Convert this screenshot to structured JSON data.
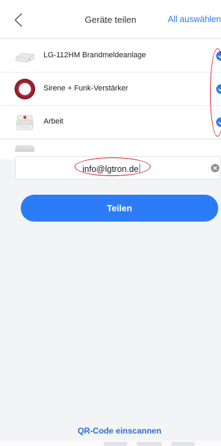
{
  "header": {
    "title": "Geräte teilen",
    "select_all": "All auswählen",
    "back_icon": "chevron-left-icon"
  },
  "devices": [
    {
      "name": "LG-112HM Brandmeldeanlage",
      "selected": true,
      "thumb": "gateway-device"
    },
    {
      "name": "Sirene + Funk-Verstärker",
      "selected": true,
      "thumb": "siren-device"
    },
    {
      "name": "Arbeit",
      "selected": true,
      "thumb": "smoke-detector-device"
    }
  ],
  "share": {
    "email_value": "info@lgtron.de",
    "share_button": "Teilen",
    "clear_icon": "clear-icon"
  },
  "footer": {
    "qr_link": "QR-Code einscannen"
  },
  "colors": {
    "accent": "#2b7cf6",
    "annotation": "#d4202a",
    "background": "#f3f4f6"
  }
}
